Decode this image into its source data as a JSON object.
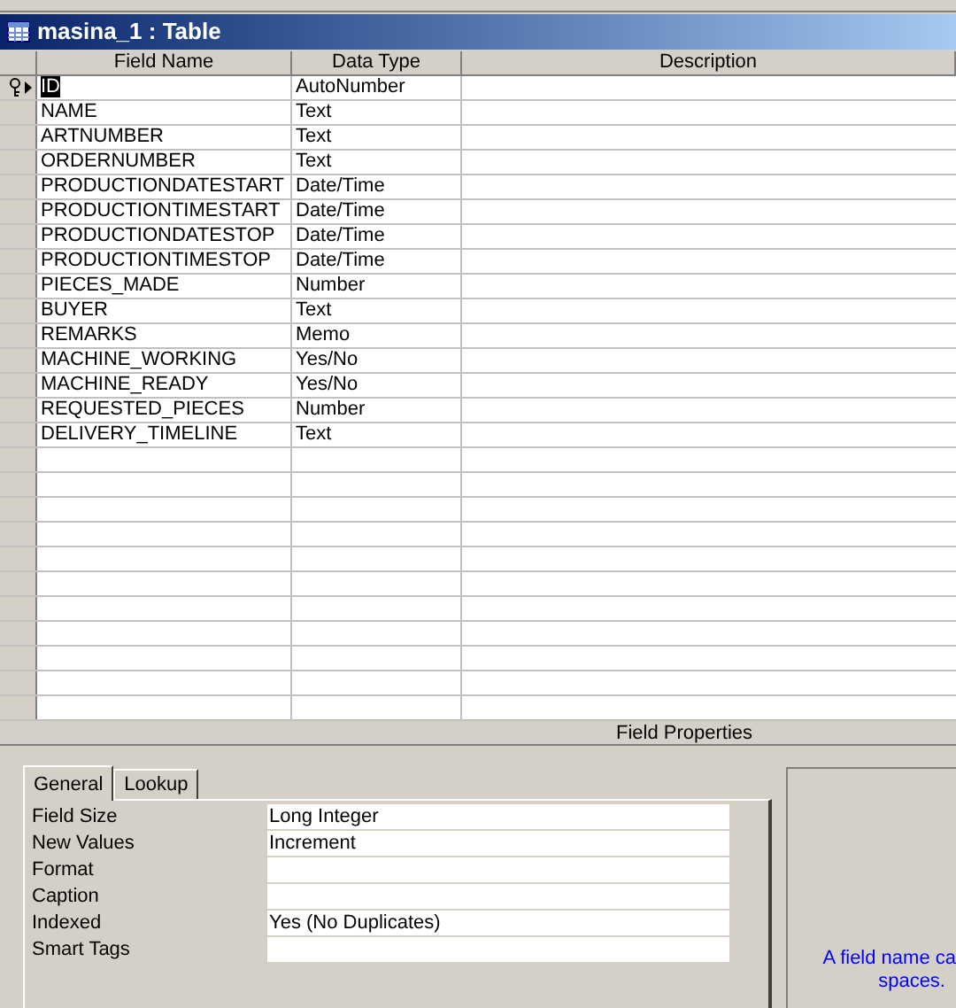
{
  "window": {
    "title": "masina_1 : Table"
  },
  "table": {
    "columns": [
      "Field Name",
      "Data Type",
      "Description"
    ],
    "rows": [
      {
        "field_name": "ID",
        "data_type": "AutoNumber",
        "primary_key": true,
        "selected": true
      },
      {
        "field_name": "NAME",
        "data_type": "Text",
        "primary_key": false,
        "selected": false
      },
      {
        "field_name": "ARTNUMBER",
        "data_type": "Text",
        "primary_key": false,
        "selected": false
      },
      {
        "field_name": "ORDERNUMBER",
        "data_type": "Text",
        "primary_key": false,
        "selected": false
      },
      {
        "field_name": "PRODUCTIONDATESTART",
        "data_type": "Date/Time",
        "primary_key": false,
        "selected": false
      },
      {
        "field_name": "PRODUCTIONTIMESTART",
        "data_type": "Date/Time",
        "primary_key": false,
        "selected": false
      },
      {
        "field_name": "PRODUCTIONDATESTOP",
        "data_type": "Date/Time",
        "primary_key": false,
        "selected": false
      },
      {
        "field_name": "PRODUCTIONTIMESTOP",
        "data_type": "Date/Time",
        "primary_key": false,
        "selected": false
      },
      {
        "field_name": "PIECES_MADE",
        "data_type": "Number",
        "primary_key": false,
        "selected": false
      },
      {
        "field_name": "BUYER",
        "data_type": "Text",
        "primary_key": false,
        "selected": false
      },
      {
        "field_name": "REMARKS",
        "data_type": "Memo",
        "primary_key": false,
        "selected": false
      },
      {
        "field_name": "MACHINE_WORKING",
        "data_type": "Yes/No",
        "primary_key": false,
        "selected": false
      },
      {
        "field_name": "MACHINE_READY",
        "data_type": "Yes/No",
        "primary_key": false,
        "selected": false
      },
      {
        "field_name": "REQUESTED_PIECES",
        "data_type": "Number",
        "primary_key": false,
        "selected": false
      },
      {
        "field_name": "DELIVERY_TIMELINE",
        "data_type": "Text",
        "primary_key": false,
        "selected": false
      }
    ]
  },
  "field_properties": {
    "title": "Field Properties",
    "tabs": [
      {
        "label": "General",
        "selected": true
      },
      {
        "label": "Lookup",
        "selected": false
      }
    ],
    "properties": [
      {
        "label": "Field Size",
        "value": "Long Integer"
      },
      {
        "label": "New Values",
        "value": "Increment"
      },
      {
        "label": "Format"
      },
      {
        "label": "Caption"
      },
      {
        "label": "Indexed",
        "value": "Yes (No Duplicates)"
      },
      {
        "label": "Smart Tags"
      }
    ],
    "help_text": [
      "A field name ca",
      "spaces."
    ]
  }
}
